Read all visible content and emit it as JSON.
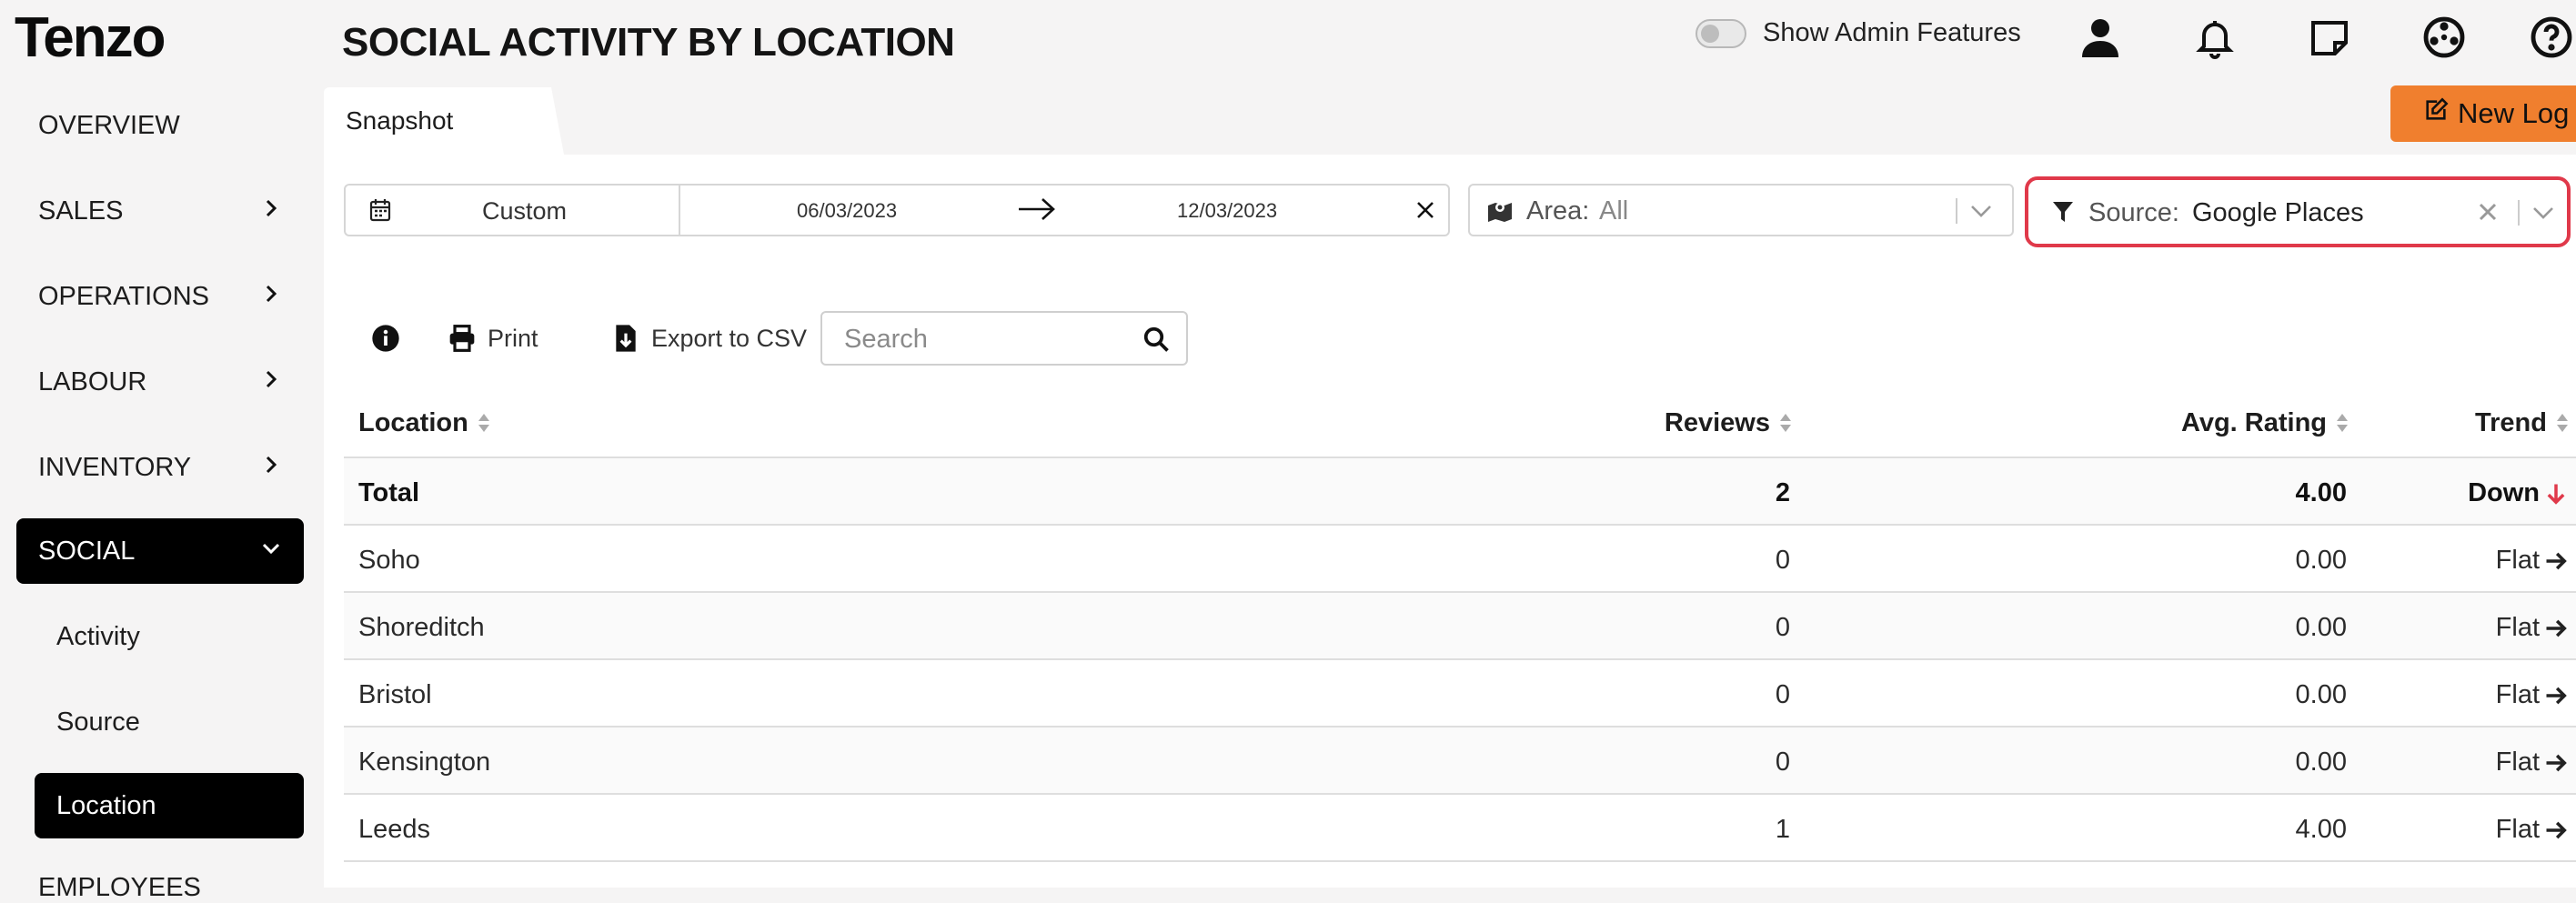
{
  "app": {
    "logo_text": "Tenzo",
    "page_title": "SOCIAL ACTIVITY BY LOCATION",
    "admin_toggle_label": "Show Admin Features",
    "admin_toggle_on": false
  },
  "header_icons": [
    "user-icon",
    "bell-icon",
    "sticky-note-icon",
    "settings-icon",
    "help-icon"
  ],
  "sidebar": {
    "items": [
      {
        "label": "OVERVIEW",
        "has_chevron": false
      },
      {
        "label": "SALES",
        "has_chevron": true
      },
      {
        "label": "OPERATIONS",
        "has_chevron": true
      },
      {
        "label": "LABOUR",
        "has_chevron": true
      },
      {
        "label": "INVENTORY",
        "has_chevron": true
      },
      {
        "label": "SOCIAL",
        "has_chevron": true,
        "expanded": true,
        "active": true
      }
    ],
    "sub_items": [
      {
        "label": "Activity"
      },
      {
        "label": "Source"
      },
      {
        "label": "Location",
        "active": true
      }
    ],
    "cut_off_item": "EMPLOYEES"
  },
  "tabs": [
    {
      "label": "Snapshot",
      "active": true
    }
  ],
  "new_log_label": "New Log",
  "filters": {
    "date_preset": "Custom",
    "start_date": "06/03/2023",
    "end_date": "12/03/2023",
    "area_label": "Area:",
    "area_value": "All",
    "source_label": "Source:",
    "source_value": "Google Places"
  },
  "toolbar": {
    "print_label": "Print",
    "export_label": "Export to CSV",
    "search_placeholder": "Search"
  },
  "table": {
    "columns": [
      "Location",
      "Reviews",
      "Avg. Rating",
      "Trend"
    ],
    "total": {
      "location": "Total",
      "reviews": "2",
      "avg_rating": "4.00",
      "trend": "Down",
      "trend_dir": "down"
    },
    "rows": [
      {
        "location": "Soho",
        "reviews": "0",
        "avg_rating": "0.00",
        "trend": "Flat",
        "trend_dir": "flat"
      },
      {
        "location": "Shoreditch",
        "reviews": "0",
        "avg_rating": "0.00",
        "trend": "Flat",
        "trend_dir": "flat"
      },
      {
        "location": "Bristol",
        "reviews": "0",
        "avg_rating": "0.00",
        "trend": "Flat",
        "trend_dir": "flat"
      },
      {
        "location": "Kensington",
        "reviews": "0",
        "avg_rating": "0.00",
        "trend": "Flat",
        "trend_dir": "flat"
      },
      {
        "location": "Leeds",
        "reviews": "1",
        "avg_rating": "4.00",
        "trend": "Flat",
        "trend_dir": "flat"
      }
    ]
  },
  "colors": {
    "accent_orange": "#f07f2e",
    "highlight_red": "#e0394a",
    "trend_down": "#e0394a",
    "active_nav_bg": "#000000"
  }
}
